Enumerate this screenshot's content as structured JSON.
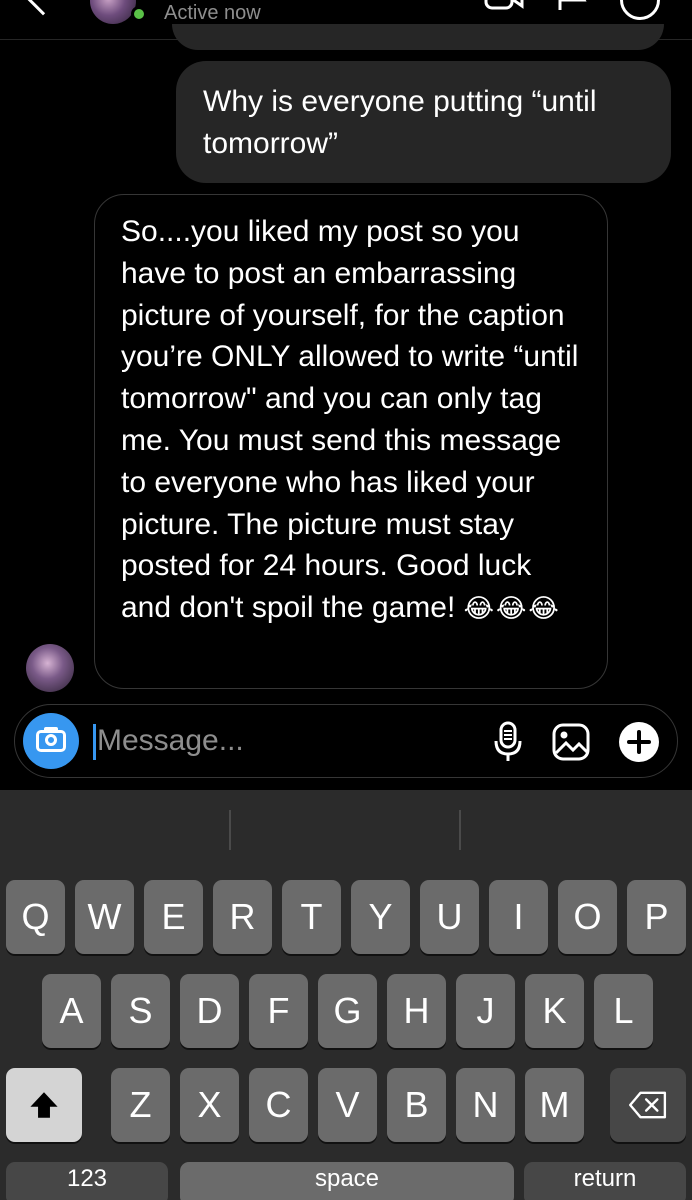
{
  "header": {
    "status": "Active now"
  },
  "messages": [
    {
      "sender": "me",
      "text": "Why is everyone putting “until tomorrow”"
    },
    {
      "sender": "them",
      "text": "So....you liked my post so you have to post an embarrassing picture of yourself, for the caption you’re ONLY allowed to write “until tomorrow\" and you can only tag me.  You must send this message to everyone who has liked your picture. The picture must stay posted for 24 hours.  Good luck and don't spoil the game!",
      "emoji": "😂😂😂"
    }
  ],
  "composer": {
    "placeholder": "Message..."
  },
  "keyboard": {
    "row1": [
      "Q",
      "W",
      "E",
      "R",
      "T",
      "Y",
      "U",
      "I",
      "O",
      "P"
    ],
    "row2": [
      "A",
      "S",
      "D",
      "F",
      "G",
      "H",
      "J",
      "K",
      "L"
    ],
    "row3": [
      "Z",
      "X",
      "C",
      "V",
      "B",
      "N",
      "M"
    ],
    "numbers_label": "123",
    "space_label": "space",
    "return_label": "return",
    "shift_icon": "shift-arrow-icon",
    "delete_icon": "backspace-icon"
  },
  "icons": {
    "back": "chevron-left-icon",
    "video": "video-call-icon",
    "flag": "flag-icon",
    "info": "info-icon",
    "camera": "camera-icon",
    "mic": "microphone-icon",
    "gallery": "gallery-icon",
    "plus": "plus-icon"
  },
  "colors": {
    "accent": "#3797f0",
    "online": "#5ac147",
    "bubble": "#262626"
  }
}
